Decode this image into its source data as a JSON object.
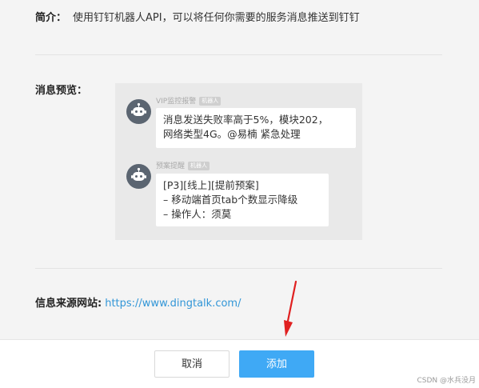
{
  "intro": {
    "label": "简介：",
    "text": "使用钉钉机器人API，可以将任何你需要的服务消息推送到钉钉"
  },
  "preview": {
    "label": "消息预览：",
    "messages": [
      {
        "sender": "VIP监控报警",
        "badge": "机器人",
        "lines": [
          "消息发送失败率高于5%，模块202，",
          "网络类型4G。@易楠 紧急处理"
        ]
      },
      {
        "sender": "预案提醒",
        "badge": "机器人",
        "lines": [
          "[P3][线上][提前预案]",
          "– 移动端首页tab个数显示降级",
          "– 操作人：须莫"
        ]
      }
    ]
  },
  "source": {
    "label": "信息来源网站:",
    "link": "https://www.dingtalk.com/"
  },
  "footer": {
    "cancel_label": "取消",
    "add_label": "添加"
  },
  "watermark": "CSDN @水兵没月",
  "colors": {
    "background": "#f4f4f4",
    "preview_box": "#e9e9e9",
    "accent": "#3fa9f5",
    "link": "#3296d7",
    "avatar": "#5b6571",
    "arrow": "#e02020"
  },
  "icons": {
    "avatar": "robot-icon"
  }
}
